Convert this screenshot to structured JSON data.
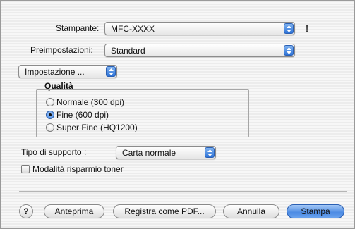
{
  "printer": {
    "label": "Stampante:",
    "value": "MFC-XXXX"
  },
  "presets": {
    "label": "Preimpostazioni:",
    "value": "Standard"
  },
  "panel": {
    "value": "Impostazione ..."
  },
  "quality": {
    "title": "Qualità",
    "options": [
      {
        "label": "Normale (300 dpi)",
        "selected": false
      },
      {
        "label": "Fine (600 dpi)",
        "selected": true
      },
      {
        "label": "Super Fine (HQ1200)",
        "selected": false
      }
    ]
  },
  "media": {
    "label": "Tipo di supporto :",
    "value": "Carta normale"
  },
  "toner_save": {
    "label": "Modalità risparmio toner",
    "checked": false
  },
  "buttons": {
    "help": "?",
    "preview": "Anteprima",
    "save_pdf": "Registra come PDF...",
    "cancel": "Annulla",
    "print": "Stampa"
  },
  "colors": {
    "accent": "#4b8ae3"
  }
}
